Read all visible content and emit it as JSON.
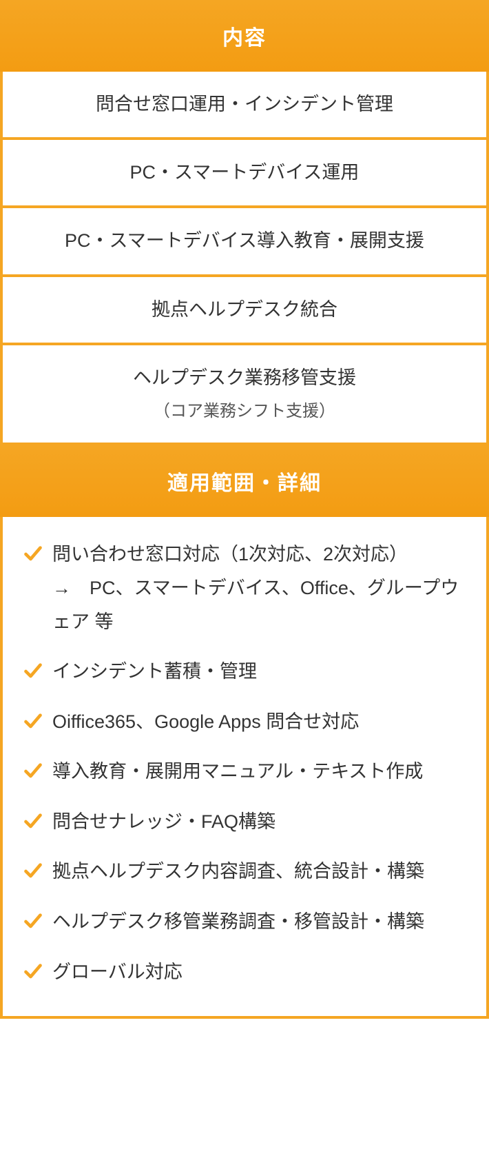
{
  "sections": {
    "content": {
      "title": "内容",
      "rows": [
        {
          "main": "問合せ窓口運用・インシデント管理",
          "sub": ""
        },
        {
          "main": "PC・スマートデバイス運用",
          "sub": ""
        },
        {
          "main": "PC・スマートデバイス導入教育・展開支援",
          "sub": ""
        },
        {
          "main": "拠点ヘルプデスク統合",
          "sub": ""
        },
        {
          "main": "ヘルプデスク業務移管支援",
          "sub": "（コア業務シフト支援）"
        }
      ]
    },
    "details": {
      "title": "適用範囲・詳細",
      "items": [
        "問い合わせ窓口対応（1次対応、2次対応）\n→　PC、スマートデバイス、Office、グループウェア 等",
        "インシデント蓄積・管理",
        "Oiffice365、Google Apps 問合せ対応",
        "導入教育・展開用マニュアル・テキスト作成",
        "問合せナレッジ・FAQ構築",
        "拠点ヘルプデスク内容調査、統合設計・構築",
        "ヘルプデスク移管業務調査・移管設計・構築",
        "グローバル対応"
      ]
    }
  },
  "colors": {
    "accent": "#f5a623"
  }
}
